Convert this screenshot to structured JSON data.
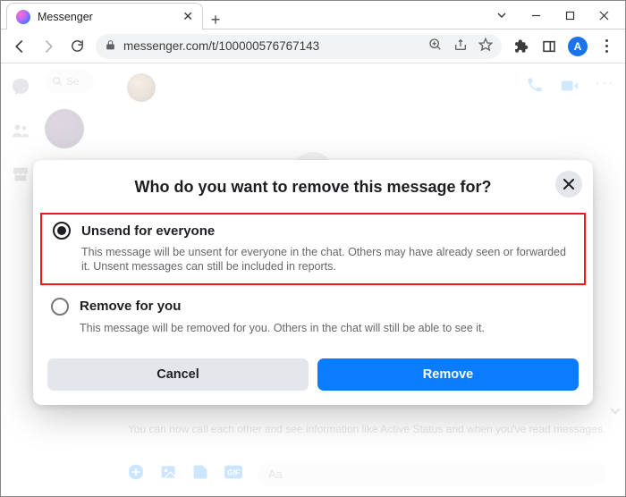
{
  "window": {
    "tab_title": "Messenger",
    "url": "messenger.com/t/100000576767143",
    "profile_letter": "A"
  },
  "sidebar": {
    "search_placeholder": "Se"
  },
  "composer": {
    "placeholder": "Aa"
  },
  "background_info": "You can now call each other and see information like Active Status and when you've read messages.",
  "modal": {
    "title": "Who do you want to remove this message for?",
    "options": [
      {
        "label": "Unsend for everyone",
        "description": "This message will be unsent for everyone in the chat. Others may have already seen or forwarded it. Unsent messages can still be included in reports.",
        "selected": true
      },
      {
        "label": "Remove for you",
        "description": "This message will be removed for you. Others in the chat will still be able to see it.",
        "selected": false
      }
    ],
    "cancel_label": "Cancel",
    "confirm_label": "Remove"
  }
}
